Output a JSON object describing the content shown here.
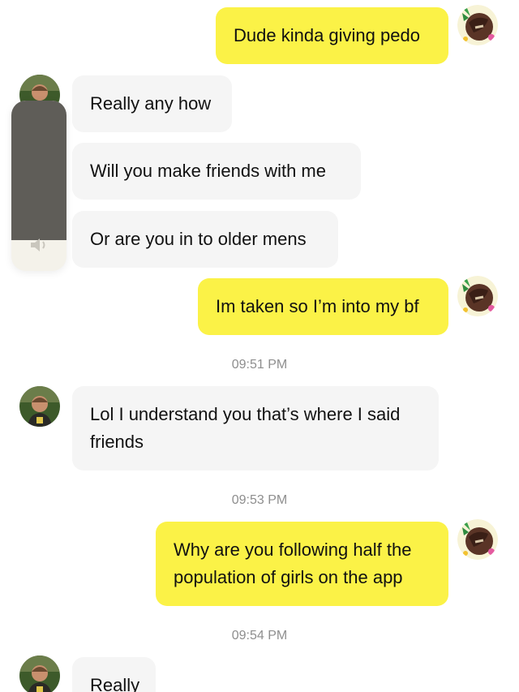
{
  "colors": {
    "outgoing_bubble": "#fbf247",
    "incoming_bubble": "#f5f5f5",
    "timestamp_text": "#8e8e8e",
    "volume_fill": "#5f5d58",
    "volume_track": "#f4f2ea"
  },
  "volume_hud": {
    "icon": "speaker-icon",
    "level_fraction": 0.82
  },
  "messages": [
    {
      "direction": "out",
      "text": "Dude kinda giving pedo"
    },
    {
      "direction": "in",
      "text": "Really any how"
    },
    {
      "direction": "in",
      "text": "Will you make friends with me"
    },
    {
      "direction": "in",
      "text": "Or are you in to older mens"
    },
    {
      "direction": "out",
      "text": "Im taken so I’m into my bf"
    },
    {
      "direction": "in",
      "text": "Lol I understand you that’s where I said friends"
    },
    {
      "direction": "out",
      "text": "Why are you following half the population of girls on the app"
    },
    {
      "direction": "in",
      "text": "Really"
    }
  ],
  "timestamps": [
    "09:51 PM",
    "09:53 PM",
    "09:54 PM"
  ]
}
